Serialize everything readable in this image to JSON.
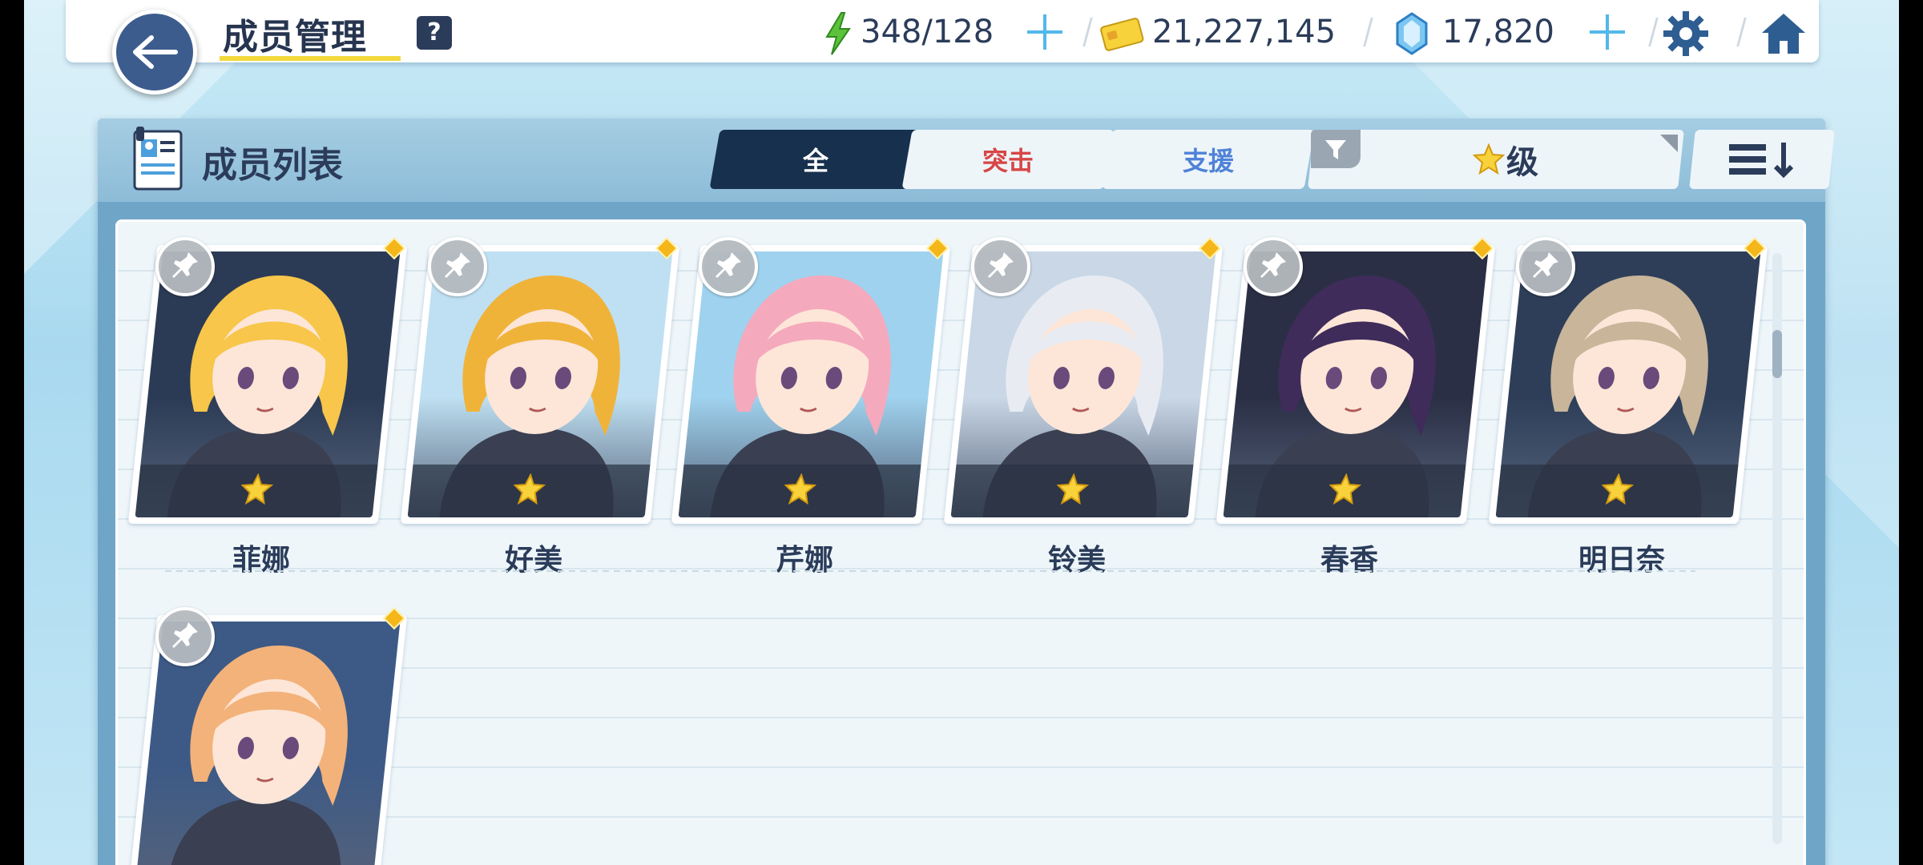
{
  "header": {
    "title": "成员管理",
    "help_label": "?",
    "ap": "348/128",
    "credits": "21,227,145",
    "gems": "17,820"
  },
  "panel": {
    "title": "成员列表",
    "tabs": [
      {
        "label": "全",
        "active": true
      },
      {
        "label": "突击",
        "active": false
      },
      {
        "label": "支援",
        "active": false
      }
    ],
    "sort_label": "级"
  },
  "members": [
    {
      "name": "菲娜",
      "stars": 1,
      "hair": "#f7c64a",
      "bg": "#2c3b55"
    },
    {
      "name": "好美",
      "stars": 1,
      "hair": "#f0b33a",
      "bg": "#bfe0f2"
    },
    {
      "name": "芹娜",
      "stars": 1,
      "hair": "#f5a9bd",
      "bg": "#9fd2ee"
    },
    {
      "name": "铃美",
      "stars": 1,
      "hair": "#e8ecf2",
      "bg": "#c9d7e6"
    },
    {
      "name": "春香",
      "stars": 1,
      "hair": "#3f2c5a",
      "bg": "#2a2f45"
    },
    {
      "name": "明日奈",
      "stars": 1,
      "hair": "#c8b59a",
      "bg": "#2e3e58"
    },
    {
      "name": "",
      "stars": 0,
      "hair": "#f3b27a",
      "bg": "#3d5a86"
    }
  ],
  "colors": {
    "accent_dark": "#17304e",
    "striker": "#d84545",
    "special": "#4f82d8",
    "star": "#f8d23a"
  },
  "icons": [
    "back-arrow-icon",
    "help-icon",
    "ap-bolt-icon",
    "credit-card-icon",
    "gem-icon",
    "plus-icon",
    "settings-gear-icon",
    "home-icon",
    "member-list-icon",
    "filter-icon",
    "star-icon",
    "sort-order-icon",
    "pin-icon"
  ]
}
